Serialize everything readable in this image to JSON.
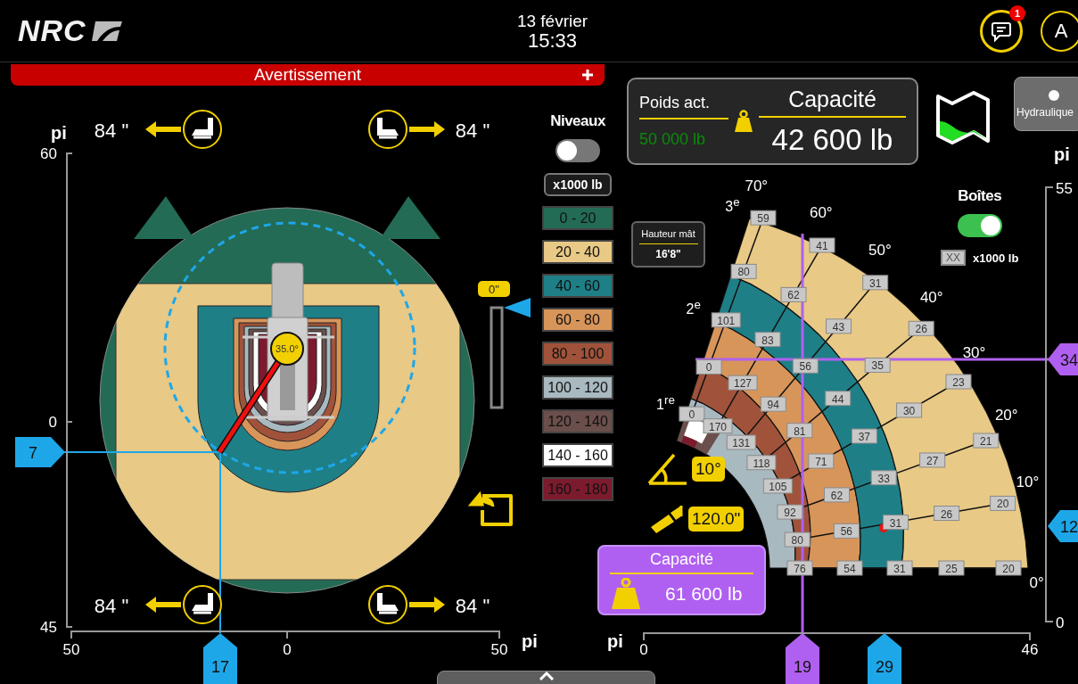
{
  "header": {
    "logo": "NRC",
    "date": "13 février",
    "time": "15:33",
    "notifications": "1",
    "user_initial": "A"
  },
  "warning_bar": {
    "label": "Avertissement"
  },
  "plan_view": {
    "y_axis": {
      "unit": "pi",
      "ticks": [
        "60",
        "0",
        "45"
      ]
    },
    "x_axis": {
      "unit": "pi",
      "ticks": [
        "50",
        "0",
        "50"
      ]
    },
    "markers": [
      {
        "value": "7",
        "kind": "actual"
      },
      {
        "value": "17",
        "kind": "actual"
      }
    ],
    "swing_angle": "35.0°",
    "outriggers": [
      {
        "extension": "84 \""
      },
      {
        "extension": "84 \""
      },
      {
        "extension": "84 \""
      },
      {
        "extension": "84 \""
      }
    ],
    "height_slider": {
      "reading": "0\""
    }
  },
  "legend": {
    "title": "Niveaux",
    "on": false,
    "unit": "x1000 lb",
    "bands": [
      {
        "label": "0 - 20",
        "color": "#236b55"
      },
      {
        "label": "20 - 40",
        "color": "#e8c986"
      },
      {
        "label": "40 - 60",
        "color": "#1f7f87"
      },
      {
        "label": "60 - 80",
        "color": "#d8955a"
      },
      {
        "label": "80 - 100",
        "color": "#a0533a"
      },
      {
        "label": "100 - 120",
        "color": "#a9b9c0"
      },
      {
        "label": "120 - 140",
        "color": "#6b4f4c"
      },
      {
        "label": "140 - 160",
        "color": "#ffffff"
      },
      {
        "label": "160 - 180",
        "color": "#7d1b2e"
      }
    ]
  },
  "weight_panel": {
    "current_label": "Poids act.",
    "current_value": "50 000 lb",
    "capacity_label": "Capacité",
    "capacity_value": "42 600 lb"
  },
  "hydraulics_button": {
    "label": "Hydraulique"
  },
  "load_chart": {
    "y_axis": {
      "unit": "pi",
      "ticks": [
        "55",
        "0"
      ]
    },
    "x_axis": {
      "unit": "pi",
      "ticks": [
        "0",
        "46"
      ]
    },
    "boxes_toggle": {
      "label": "Boîtes",
      "on": true
    },
    "box_legend": {
      "sample": "XX",
      "unit": "x1000 lb"
    },
    "mast_height": {
      "label": "Hauteur mât",
      "value": "16'8\""
    },
    "boom_angle": "10°",
    "boom_extension": "120.0\"",
    "sections": [
      "1$^{re}$",
      "2$^{e}$",
      "3$^{e}$"
    ],
    "rays": [
      {
        "angle": "70°",
        "values": [
          "0",
          "0",
          "101",
          "80",
          "59"
        ]
      },
      {
        "angle": "60°",
        "values": [
          "170",
          "127",
          "83",
          "62",
          "41"
        ]
      },
      {
        "angle": "50°",
        "values": [
          "131",
          "94",
          "56",
          "43",
          "31"
        ]
      },
      {
        "angle": "40°",
        "values": [
          "118",
          "81",
          "44",
          "35",
          "26"
        ]
      },
      {
        "angle": "30°",
        "values": [
          "105",
          "71",
          "37",
          "30",
          "23"
        ]
      },
      {
        "angle": "20°",
        "values": [
          "92",
          "62",
          "33",
          "27",
          "21"
        ]
      },
      {
        "angle": "10°",
        "values": [
          "80",
          "56",
          "31",
          "26",
          "20"
        ]
      },
      {
        "angle": "0°",
        "values": [
          "76",
          "54",
          "31",
          "25",
          "20"
        ]
      }
    ],
    "markers": [
      {
        "value": "34",
        "kind": "target"
      },
      {
        "value": "12",
        "kind": "actual"
      },
      {
        "value": "19",
        "kind": "target"
      },
      {
        "value": "29",
        "kind": "actual"
      }
    ]
  },
  "capacity_card": {
    "title": "Capacité",
    "value": "61 600 lb"
  }
}
